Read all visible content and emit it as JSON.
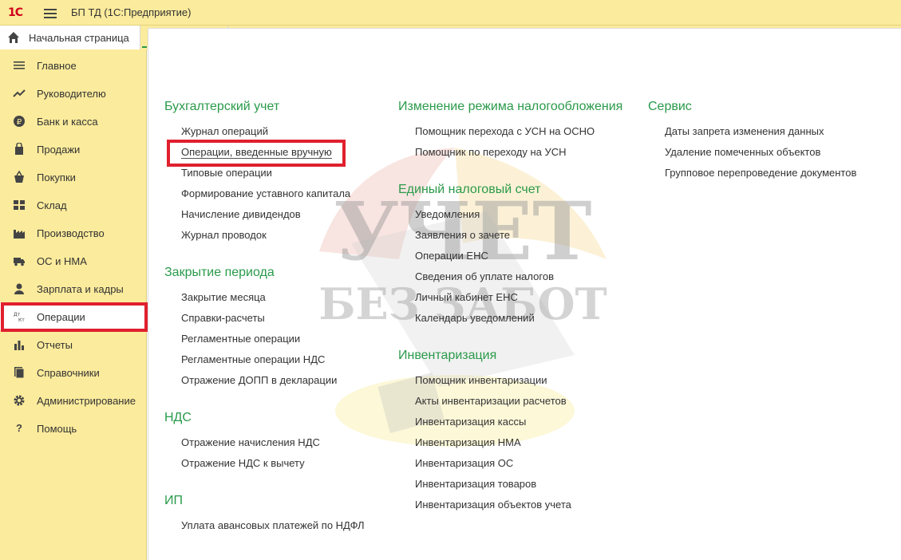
{
  "titlebar": {
    "logo": "1С",
    "title": "БП ТД  (1С:Предприятие)"
  },
  "tabs": {
    "home": "Начальная страница"
  },
  "sidebar": {
    "items": [
      {
        "label": "Главное",
        "icon": "menu-lines-icon"
      },
      {
        "label": "Руководителю",
        "icon": "trend-icon"
      },
      {
        "label": "Банк и касса",
        "icon": "ruble-icon"
      },
      {
        "label": "Продажи",
        "icon": "bag-icon"
      },
      {
        "label": "Покупки",
        "icon": "basket-icon"
      },
      {
        "label": "Склад",
        "icon": "warehouse-icon"
      },
      {
        "label": "Производство",
        "icon": "factory-icon"
      },
      {
        "label": "ОС и НМА",
        "icon": "truck-icon"
      },
      {
        "label": "Зарплата и кадры",
        "icon": "person-icon"
      },
      {
        "label": "Операции",
        "icon": "dt-kt-icon"
      },
      {
        "label": "Отчеты",
        "icon": "bar-chart-icon"
      },
      {
        "label": "Справочники",
        "icon": "book-icon"
      },
      {
        "label": "Администрирование",
        "icon": "gear-icon"
      },
      {
        "label": "Помощь",
        "icon": "question-icon"
      }
    ]
  },
  "main": {
    "accounting": {
      "title": "Бухгалтерский учет",
      "links": [
        "Журнал операций",
        "Операции, введенные вручную",
        "Типовые операции",
        "Формирование уставного капитала",
        "Начисление дивидендов",
        "Журнал проводок"
      ]
    },
    "closing": {
      "title": "Закрытие периода",
      "links": [
        "Закрытие месяца",
        "Справки-расчеты",
        "Регламентные операции",
        "Регламентные операции НДС",
        "Отражение ДОПП в декларации"
      ]
    },
    "vat": {
      "title": "НДС",
      "links": [
        "Отражение начисления НДС",
        "Отражение НДС к вычету"
      ]
    },
    "ip": {
      "title": "ИП",
      "links": [
        "Уплата авансовых платежей по НДФЛ"
      ]
    },
    "tax_mode": {
      "title": "Изменение режима налогообложения",
      "links": [
        "Помощник перехода с УСН на ОСНО",
        "Помощник по переходу на УСН"
      ]
    },
    "ens": {
      "title": "Единый налоговый счет",
      "links": [
        "Уведомления",
        "Заявления о зачете",
        "Операции ЕНС",
        "Сведения об уплате налогов",
        "Личный кабинет ЕНС",
        "Календарь уведомлений"
      ]
    },
    "inventory": {
      "title": "Инвентаризация",
      "links": [
        "Помощник инвентаризации",
        "Акты инвентаризации расчетов",
        "Инвентаризация кассы",
        "Инвентаризация НМА",
        "Инвентаризация ОС",
        "Инвентаризация товаров",
        "Инвентаризация объектов учета"
      ]
    },
    "service": {
      "title": "Сервис",
      "links": [
        "Даты запрета изменения данных",
        "Удаление помеченных объектов",
        "Групповое перепроведение документов"
      ]
    }
  },
  "watermark": {
    "line1": "УЧЕТ",
    "line2": "БЕЗ ЗАБОТ"
  },
  "colors": {
    "panel": "#fbeb9c",
    "group_title": "#2a9a4a",
    "highlight": "#e0202e"
  }
}
